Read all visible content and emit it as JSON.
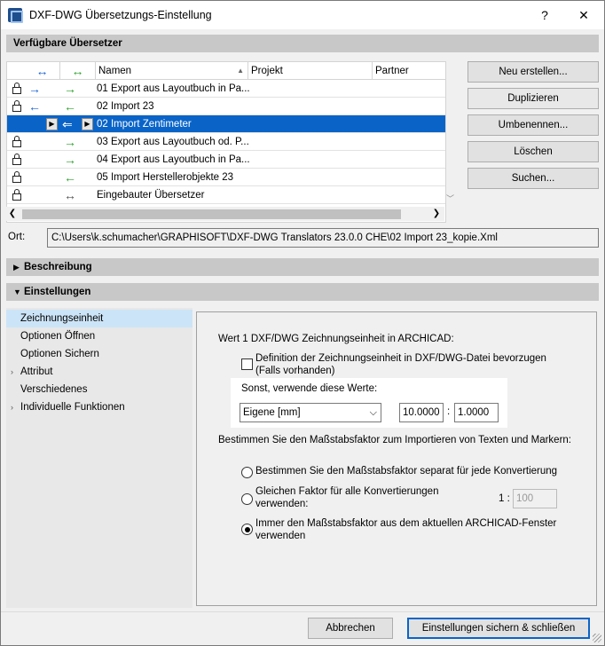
{
  "window": {
    "title": "DXF-DWG Übersetzungs-Einstellung",
    "help_label": "?",
    "close_label": "✕"
  },
  "translators": {
    "section_title": "Verfügbare Übersetzer",
    "columns": {
      "export_icon": "↔",
      "import_icon": "↔",
      "name": "Namen",
      "project": "Projekt",
      "partner": "Partner"
    },
    "sort_indicator": "▲",
    "rows": [
      {
        "name": "01 Export aus Layoutbuch in Pa...",
        "export": "→",
        "import": "→",
        "locked": true
      },
      {
        "name": "02 Import 23",
        "export": "←",
        "import": "←",
        "locked": true
      },
      {
        "name": "02 Import Zentimeter",
        "export": "",
        "import": "⇐",
        "locked": false,
        "selected": true
      },
      {
        "name": "03 Export aus Layoutbuch od. P...",
        "export": "",
        "import": "→",
        "locked": true
      },
      {
        "name": "04 Export aus Layoutbuch in Pa...",
        "export": "",
        "import": "→",
        "locked": true
      },
      {
        "name": "05 Import Herstellerobjekte 23",
        "export": "",
        "import": "←",
        "locked": true
      },
      {
        "name": "Eingebauter Übersetzer",
        "export": "",
        "import": "↔",
        "locked": true
      }
    ],
    "buttons": {
      "new": "Neu erstellen...",
      "duplicate": "Duplizieren",
      "rename": "Umbenennen...",
      "delete": "Löschen",
      "search": "Suchen..."
    }
  },
  "location": {
    "label": "Ort:",
    "value": "C:\\Users\\k.schumacher\\GRAPHISOFT\\DXF-DWG Translators 23.0.0 CHE\\02 Import 23_kopie.Xml"
  },
  "description": {
    "section_title": "Beschreibung",
    "expanded": false
  },
  "settings": {
    "section_title": "Einstellungen",
    "expanded": true,
    "tree": [
      {
        "label": "Zeichnungseinheit",
        "selected": true,
        "expandable": false
      },
      {
        "label": "Optionen Öffnen",
        "selected": false,
        "expandable": false
      },
      {
        "label": "Optionen Sichern",
        "selected": false,
        "expandable": false
      },
      {
        "label": "Attribut",
        "selected": false,
        "expandable": true
      },
      {
        "label": "Verschiedenes",
        "selected": false,
        "expandable": false
      },
      {
        "label": "Individuelle Funktionen",
        "selected": false,
        "expandable": true
      }
    ],
    "panel": {
      "heading": "Wert 1 DXF/DWG Zeichnungseinheit in ARCHICAD:",
      "prefer_file_unit": {
        "label_line1": "Definition der Zeichnungseinheit in DXF/DWG-Datei bevorzugen",
        "label_line2": "(Falls vorhanden)",
        "checked": false
      },
      "fallback_label": "Sonst, verwende diese Werte:",
      "unit_select": "Eigene [mm]",
      "unit_value_a": "10.0000",
      "ratio_sep": ":",
      "unit_value_b": "1.0000",
      "scale_heading": "Bestimmen Sie den Maßstabsfaktor zum Importieren von Texten und Markern:",
      "scale_options": [
        {
          "line1": "Bestimmen Sie den Maßstabsfaktor separat für jede Konvertierung",
          "line2": "",
          "checked": false
        },
        {
          "line1": "Gleichen Faktor für alle Konvertierungen",
          "line2": "verwenden:",
          "checked": false
        },
        {
          "line1": "Immer den Maßstabsfaktor aus dem aktuellen ARCHICAD-Fenster",
          "line2": "verwenden",
          "checked": true
        }
      ],
      "factor_prefix": "1 :",
      "factor_value": "100"
    }
  },
  "footer": {
    "cancel": "Abbrechen",
    "save_close": "Einstellungen sichern & schließen"
  },
  "colors": {
    "selection": "#0a64c8",
    "export_arrow": "#1a63d4",
    "import_arrow": "#2aa02a",
    "tree_selection": "#cce4f7"
  }
}
